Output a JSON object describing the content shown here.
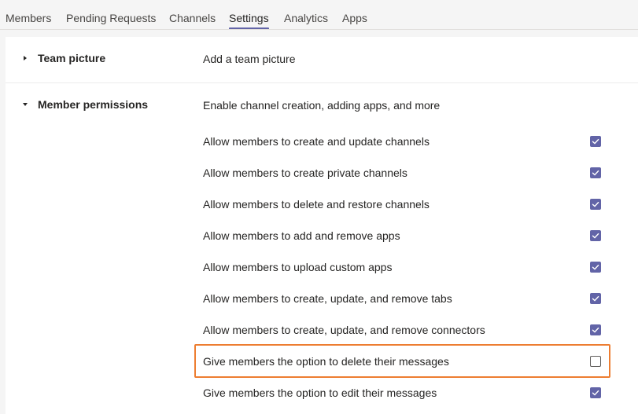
{
  "tabs": [
    {
      "label": "Members"
    },
    {
      "label": "Pending Requests"
    },
    {
      "label": "Channels"
    },
    {
      "label": "Settings",
      "active": true
    },
    {
      "label": "Analytics"
    },
    {
      "label": "Apps"
    }
  ],
  "sections": {
    "team_picture": {
      "title": "Team picture",
      "description": "Add a team picture",
      "expanded": false
    },
    "member_permissions": {
      "title": "Member permissions",
      "description": "Enable channel creation, adding apps, and more",
      "expanded": true,
      "items": [
        {
          "label": "Allow members to create and update channels",
          "checked": true
        },
        {
          "label": "Allow members to create private channels",
          "checked": true
        },
        {
          "label": "Allow members to delete and restore channels",
          "checked": true
        },
        {
          "label": "Allow members to add and remove apps",
          "checked": true
        },
        {
          "label": "Allow members to upload custom apps",
          "checked": true
        },
        {
          "label": "Allow members to create, update, and remove tabs",
          "checked": true
        },
        {
          "label": "Allow members to create, update, and remove connectors",
          "checked": true
        },
        {
          "label": "Give members the option to delete their messages",
          "checked": false,
          "highlighted": true
        },
        {
          "label": "Give members the option to edit their messages",
          "checked": true
        }
      ]
    }
  },
  "colors": {
    "accent": "#6264a7",
    "highlight": "#ed7d31"
  }
}
